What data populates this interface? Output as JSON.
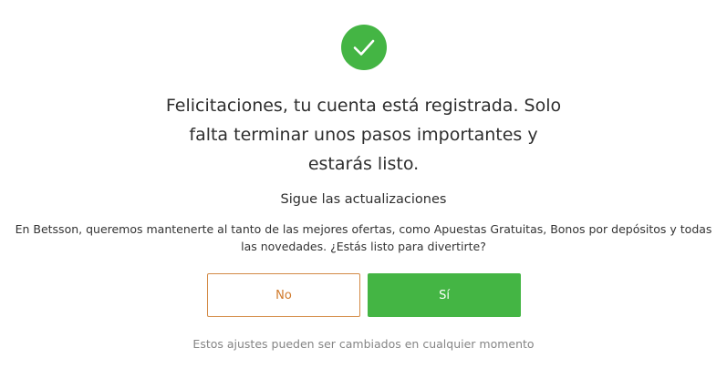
{
  "colors": {
    "accent_green": "#44b544",
    "secondary_orange": "#d07a2c",
    "muted_text": "#858585"
  },
  "icon": {
    "name": "checkmark-icon"
  },
  "dialog": {
    "headline": "Felicitaciones, tu cuenta está registrada. Solo falta terminar unos pasos importantes y estarás listo.",
    "subheading": "Sigue las actualizaciones",
    "description": "En Betsson, queremos mantenerte al tanto de las mejores ofertas, como Apuestas Gratuitas, Bonos por depósitos y todas las novedades. ¿Estás listo para divertirte?",
    "no_label": "No",
    "yes_label": "Sí",
    "footnote": "Estos ajustes pueden ser cambiados en cualquier momento"
  }
}
